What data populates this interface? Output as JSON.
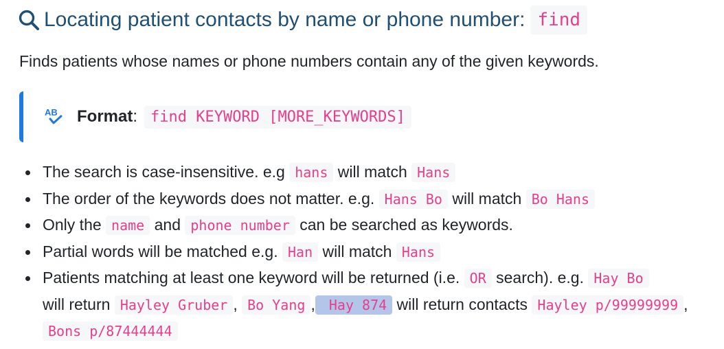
{
  "heading": {
    "text": "Locating patient contacts by name or phone number:",
    "command": "find"
  },
  "intro": "Finds patients whose names or phone numbers contain any of the given keywords.",
  "format": {
    "label": "Format",
    "colon": ":",
    "code": "find KEYWORD [MORE_KEYWORDS]",
    "icon": "spellcheck-icon"
  },
  "bullets": {
    "b1": {
      "t1": "The search is case-insensitive. e.g ",
      "c1": "hans",
      "t2": " will match ",
      "c2": "Hans"
    },
    "b2": {
      "t1": "The order of the keywords does not matter. e.g. ",
      "c1": "Hans Bo",
      "t2": " will match ",
      "c2": "Bo Hans"
    },
    "b3": {
      "t1": "Only the ",
      "c1": "name",
      "t2": " and ",
      "c2": "phone number",
      "t3": " can be searched as keywords."
    },
    "b4": {
      "t1": "Partial words will be matched e.g. ",
      "c1": "Han",
      "t2": " will match ",
      "c2": "Hans"
    },
    "b5": {
      "t1": "Patients matching at least one keyword will be returned (i.e. ",
      "c1": "OR",
      "t2": " search). e.g. ",
      "c2": "Hay Bo",
      "t3": " will return ",
      "c3": "Hayley Gruber",
      "t4": ", ",
      "c4": "Bo Yang",
      "t5": ",",
      "c5": " Hay 874",
      "t6": " will return contacts ",
      "c6": "Hayley p/99999999",
      "t7": ", ",
      "c7": "Bons p/87444444"
    }
  },
  "colors": {
    "heading": "#1f4f73",
    "code": "#e83e8c",
    "code_bg": "#f6f7f8",
    "callout_border": "#1f7ae0",
    "selection": "#b3c6ea"
  }
}
